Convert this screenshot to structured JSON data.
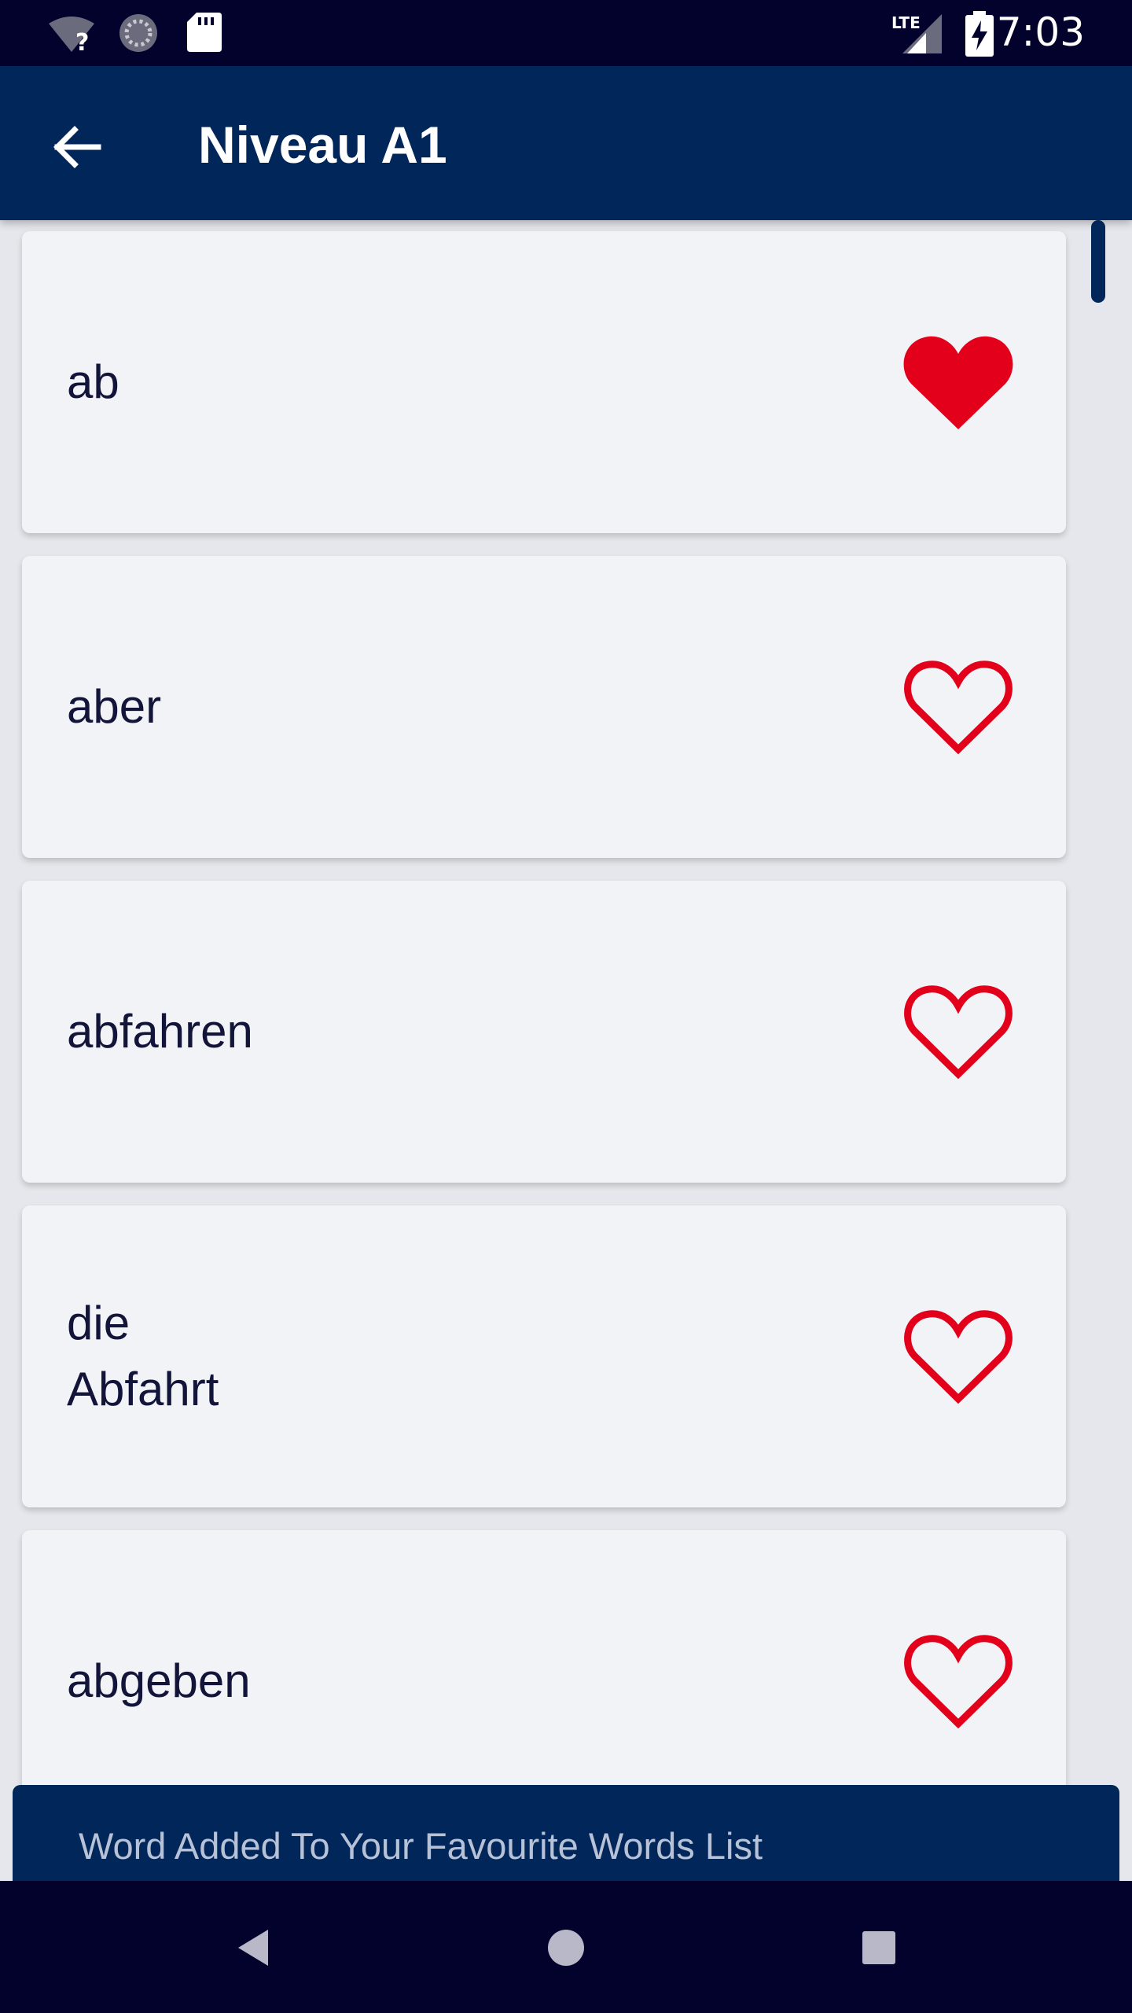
{
  "status_bar": {
    "time": "7:03",
    "network_label": "LTE",
    "icons": [
      "wifi-unknown-icon",
      "sync-icon",
      "sd-card-icon",
      "lte-signal-icon",
      "battery-charging-icon"
    ]
  },
  "app_bar": {
    "title": "Niveau A1",
    "back_icon": "arrow-back-icon"
  },
  "colors": {
    "status_bar": "#03022d",
    "app_bar": "#00265a",
    "card": "#f2f3f7",
    "heart": "#e3001b",
    "text": "#12143a",
    "snackbar_text": "#b7c2d6"
  },
  "words": [
    {
      "lines": [
        "ab"
      ],
      "favorite": true
    },
    {
      "lines": [
        "aber"
      ],
      "favorite": false
    },
    {
      "lines": [
        "abfahren"
      ],
      "favorite": false
    },
    {
      "lines": [
        "die",
        "Abfahrt"
      ],
      "favorite": false
    },
    {
      "lines": [
        "abgeben"
      ],
      "favorite": false
    }
  ],
  "snackbar": {
    "message": "Word Added To Your Favourite Words List"
  },
  "nav_bar": {
    "icons": [
      "back-triangle-icon",
      "home-circle-icon",
      "recents-square-icon"
    ]
  }
}
